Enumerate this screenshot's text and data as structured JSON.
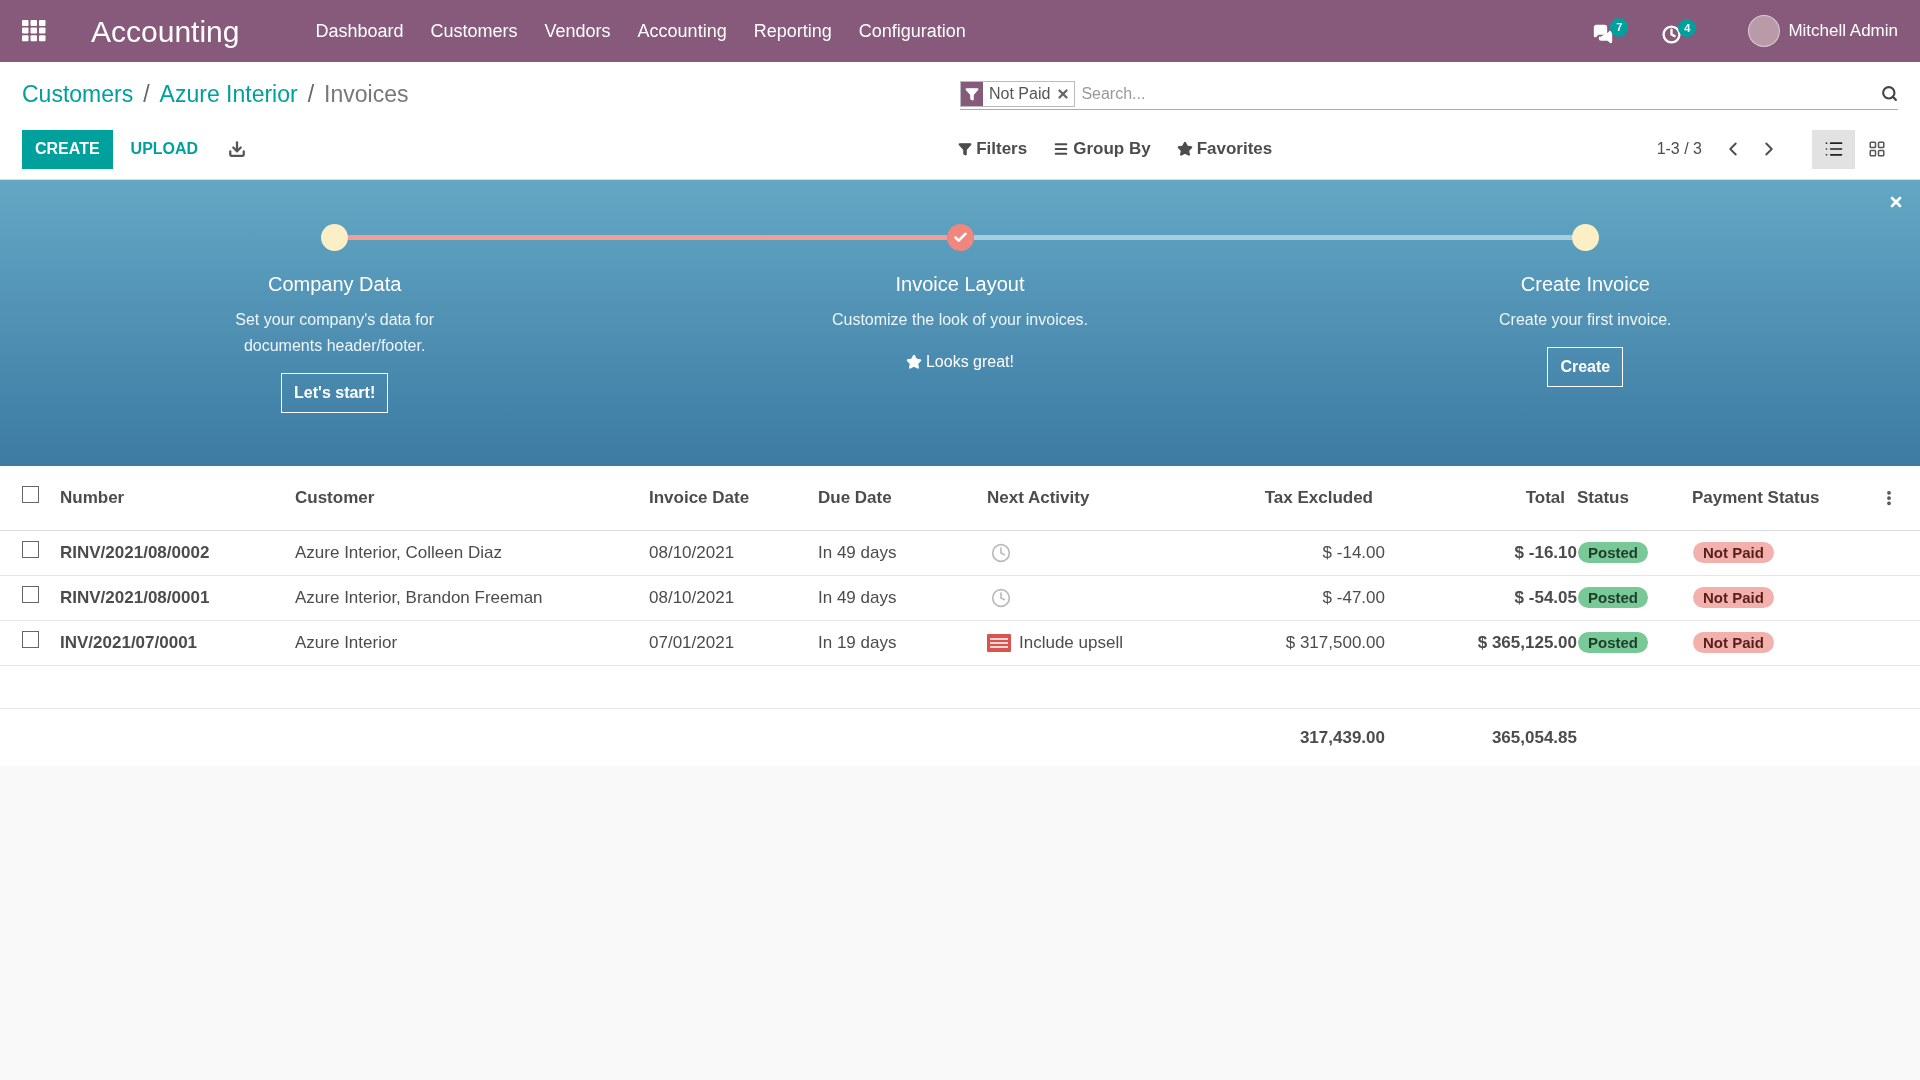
{
  "navbar": {
    "app_title": "Accounting",
    "menu": [
      "Dashboard",
      "Customers",
      "Vendors",
      "Accounting",
      "Reporting",
      "Configuration"
    ],
    "messages_count": "7",
    "activities_count": "4",
    "user": "Mitchell Admin"
  },
  "breadcrumbs": [
    "Customers",
    "Azure Interior",
    "Invoices"
  ],
  "breadcrumb_separator": "/",
  "search": {
    "facet": "Not Paid",
    "placeholder": "Search..."
  },
  "actions": {
    "create": "CREATE",
    "upload": "UPLOAD"
  },
  "filters": [
    "Filters",
    "Group By",
    "Favorites"
  ],
  "pager": "1-3 / 3",
  "views": [
    {
      "kind": "list",
      "selected": true
    },
    {
      "kind": "kanban",
      "selected": false
    }
  ],
  "onboarding": {
    "steps": [
      {
        "title": "Company Data",
        "description": "Set your company's data for documents header/footer.",
        "done": false,
        "button": "Let's start!"
      },
      {
        "title": "Invoice Layout",
        "description": "Customize the look of your invoices.",
        "done": true,
        "status_text": "Looks great!"
      },
      {
        "title": "Create Invoice",
        "description": "Create your first invoice.",
        "done": false,
        "button": "Create"
      }
    ]
  },
  "table": {
    "select_all_checked": false,
    "columns": [
      "Number",
      "Customer",
      "Invoice Date",
      "Due Date",
      "Next Activity",
      "Tax Excluded",
      "Total",
      "Status",
      "Payment Status"
    ],
    "rows": [
      {
        "checked": false,
        "number": "RINV/2021/08/0002",
        "customer": "Azure Interior, Colleen Diaz",
        "invoice_date": "08/10/2021",
        "due_date": "In 49 days",
        "activity": {
          "kind": "clock"
        },
        "tax_excluded": "$ -14.00",
        "total": "$ -16.10",
        "status": "Posted",
        "payment_status": "Not Paid"
      },
      {
        "checked": false,
        "number": "RINV/2021/08/0001",
        "customer": "Azure Interior, Brandon Freeman",
        "invoice_date": "08/10/2021",
        "due_date": "In 49 days",
        "activity": {
          "kind": "clock"
        },
        "tax_excluded": "$ -47.00",
        "total": "$ -54.05",
        "status": "Posted",
        "payment_status": "Not Paid"
      },
      {
        "checked": false,
        "number": "INV/2021/07/0001",
        "customer": "Azure Interior",
        "invoice_date": "07/01/2021",
        "due_date": "In 19 days",
        "activity": {
          "kind": "todo",
          "label": "Include upsell"
        },
        "tax_excluded": "$ 317,500.00",
        "total": "$ 365,125.00",
        "status": "Posted",
        "payment_status": "Not Paid"
      }
    ],
    "totals": {
      "tax_excluded": "317,439.00",
      "total": "365,054.85"
    }
  }
}
